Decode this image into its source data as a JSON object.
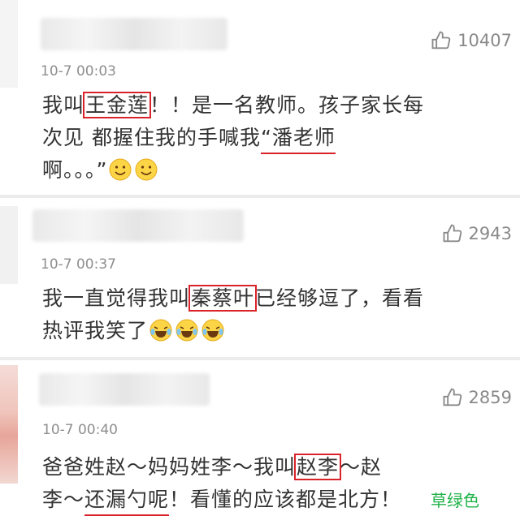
{
  "comments": [
    {
      "time": "10-7 00:03",
      "likes": "10407",
      "line1_pre": "我叫",
      "line1_box": "王金莲",
      "line1_post": "！！是一名教师。孩子家长每",
      "line2_pre": "次见 都握住我的手喊我",
      "line2_uline": "“潘老师",
      "line3": "啊。。。”"
    },
    {
      "time": "10-7 00:37",
      "likes": "2943",
      "line1_pre": "我一直觉得我叫",
      "line1_box": "秦蔡叶",
      "line1_post": "已经够逗了，看看",
      "line2": "热评我笑了"
    },
    {
      "time": "10-7 00:40",
      "likes": "2859",
      "line1_pre": "爸爸姓赵～妈妈姓李～我叫",
      "line1_box": "赵李",
      "line1_post": "～赵",
      "line2_pre": "李～",
      "line2_uline": "还漏勺呢",
      "line2_post": "！看懂的应该都是北方！"
    }
  ],
  "emojis": {
    "c1": [
      "smile-emoji",
      "smile-emoji"
    ],
    "c2": [
      "laugh-cry-emoji",
      "laugh-cry-emoji",
      "laugh-cry-emoji"
    ]
  },
  "watermark": "草绿色",
  "colors": {
    "highlight": "#d9232a",
    "meta": "#8e8e8e",
    "text": "#333333",
    "watermark": "#21b24a"
  }
}
